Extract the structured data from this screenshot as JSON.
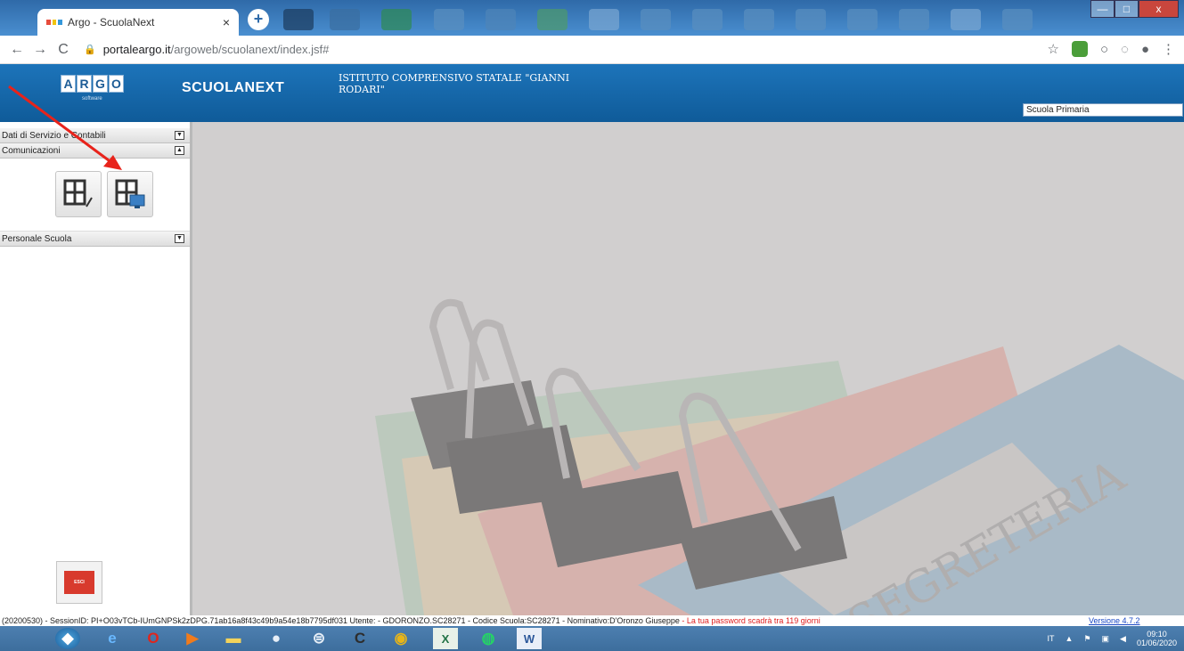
{
  "browser": {
    "tab_title": "Argo - ScuolaNext",
    "tab_close": "×",
    "new_tab": "+",
    "url_host": "portaleargo.it",
    "url_path": "/argoweb/scuolanext/index.jsf#",
    "minimize": "—",
    "maximize": "□",
    "close": "x"
  },
  "header": {
    "logo_letters": [
      "A",
      "R",
      "G",
      "O"
    ],
    "logo_sub": "software",
    "brand": "SCUOLANEXT",
    "school_name": "ISTITUTO COMPRENSIVO STATALE \"GIANNI RODARI\"",
    "school_level": "Scuola Primaria"
  },
  "sidebar": {
    "sections": [
      {
        "label": "Dati di Servizio e Contabili",
        "arrow": "▼"
      },
      {
        "label": "Comunicazioni",
        "arrow": "▲"
      },
      {
        "label": "Personale Scuola",
        "arrow": "▼"
      }
    ],
    "exit_label": "ESCI"
  },
  "main": {
    "watermark": "SEGRETERIA"
  },
  "status": {
    "session": "(20200530) - SessionID: PI+O03vTCb-IUmGNPSk2zDPG.71ab16a8f43c49b9a54e18b7795df031 Utente: - GDORONZO.SC28271 - Codice Scuola:SC28271 - Nominativo:D'Oronzo Giuseppe",
    "warning": " - La tua password scadrà tra 119 giorni",
    "version": "Versione 4.7.2"
  },
  "taskbar": {
    "lang": "IT",
    "time": "09:10",
    "date": "01/06/2020"
  },
  "colors": {
    "header": "#1d74ba",
    "arrow": "#e8231b",
    "warning": "#e02020"
  }
}
